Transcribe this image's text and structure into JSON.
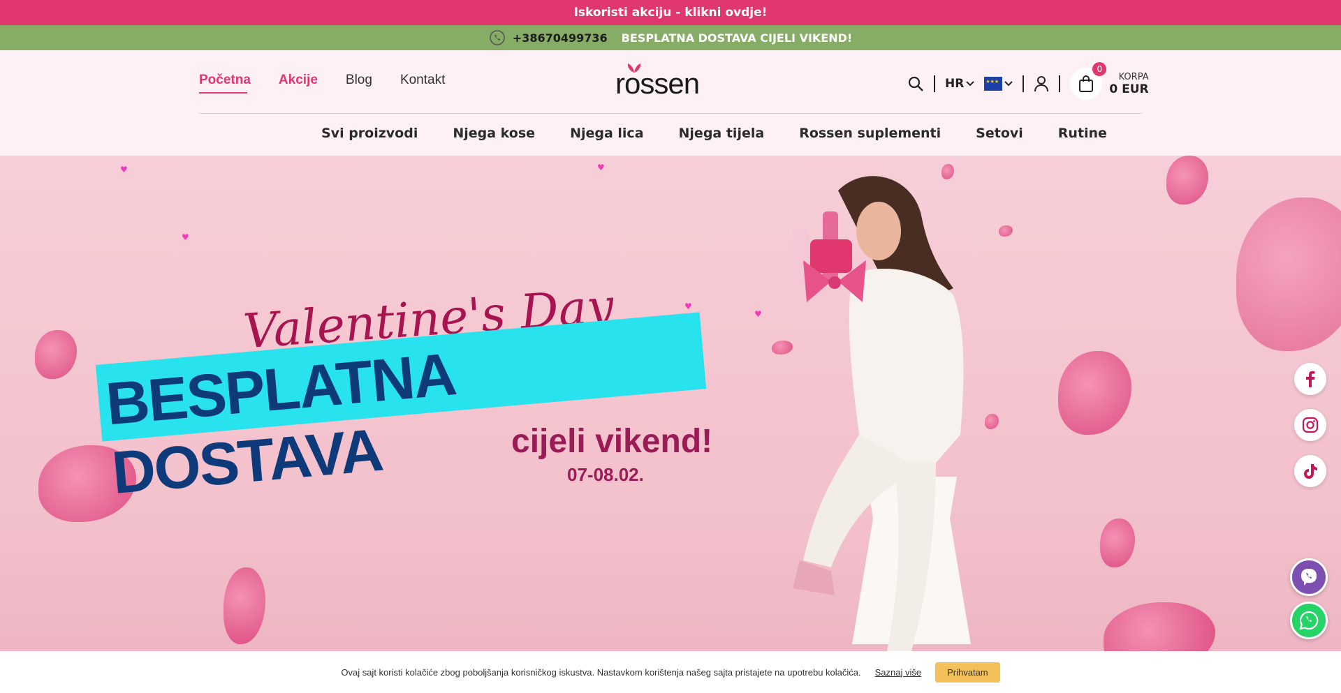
{
  "promo": {
    "text": "Iskoristi akciju - klikni ovdje!"
  },
  "info_bar": {
    "phone": "+38670499736",
    "free_shipping": "BESPLATNA DOSTAVA CIJELI VIKEND!"
  },
  "main_nav": [
    {
      "label": "Početna",
      "active": true
    },
    {
      "label": "Akcije",
      "sale": true
    },
    {
      "label": "Blog"
    },
    {
      "label": "Kontakt"
    }
  ],
  "logo": {
    "text": "rossen"
  },
  "tools": {
    "language": "HR",
    "cart_label": "KORPA",
    "cart_total": "0 EUR",
    "cart_count": "0"
  },
  "category_nav": [
    "Svi proizvodi",
    "Njega kose",
    "Njega lica",
    "Njega tijela",
    "Rossen suplementi",
    "Setovi",
    "Rutine"
  ],
  "hero": {
    "script_title": "Valentine's Day",
    "headline": "BESPLATNA DOSTAVA",
    "subline": "cijeli vikend!",
    "dates": "07-08.02."
  },
  "social": [
    "facebook-icon",
    "instagram-icon",
    "tiktok-icon"
  ],
  "chat": [
    "viber-icon",
    "whatsapp-icon"
  ],
  "cookie": {
    "text": "Ovaj sajt koristi kolačiće zbog poboljšanja korisničkog iskustva. Nastavkom korištenja našeg sajta pristajete na upotrebu kolačića.",
    "link": "Saznaj više",
    "accept": "Prihvatam"
  },
  "colors": {
    "brand_pink": "#e0386e",
    "green_bar": "#86ac66",
    "cyan": "#28e2ee",
    "navy": "#0e3a7a"
  }
}
